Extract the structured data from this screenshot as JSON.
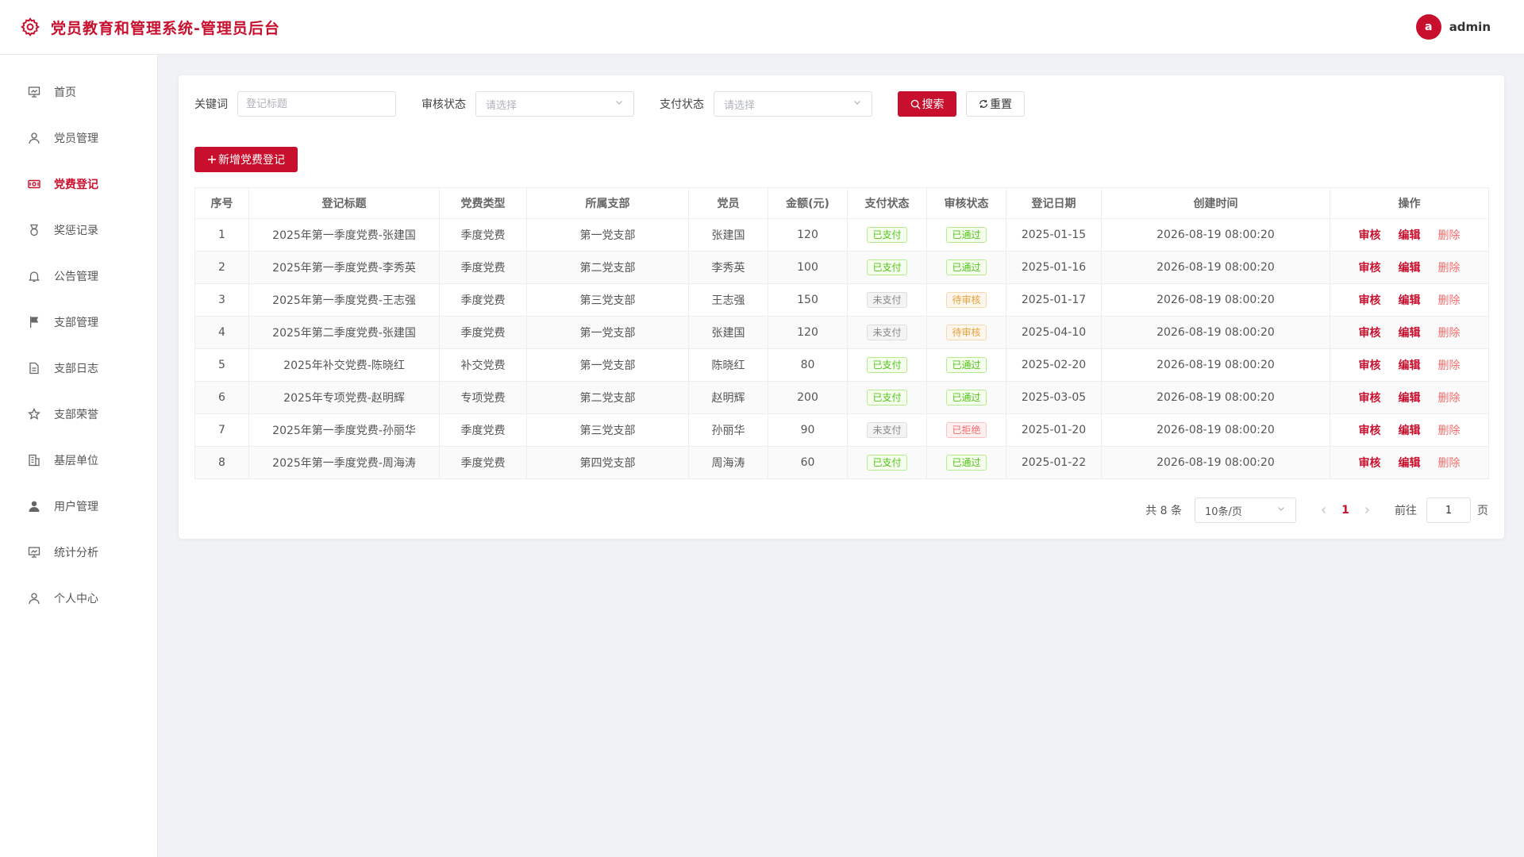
{
  "header": {
    "title": "党员教育和管理系统-管理员后台",
    "avatar_letter": "a",
    "username": "admin",
    "logo_icon": "gear-icon"
  },
  "sidebar": {
    "items": [
      {
        "label": "首页",
        "icon": "presentation-icon",
        "active": false
      },
      {
        "label": "党员管理",
        "icon": "user-icon",
        "active": false
      },
      {
        "label": "党费登记",
        "icon": "money-icon",
        "active": true
      },
      {
        "label": "奖惩记录",
        "icon": "medal-icon",
        "active": false
      },
      {
        "label": "公告管理",
        "icon": "bell-icon",
        "active": false
      },
      {
        "label": "支部管理",
        "icon": "flag-icon",
        "active": false
      },
      {
        "label": "支部日志",
        "icon": "document-icon",
        "active": false
      },
      {
        "label": "支部荣誉",
        "icon": "star-icon",
        "active": false
      },
      {
        "label": "基层单位",
        "icon": "building-icon",
        "active": false
      },
      {
        "label": "用户管理",
        "icon": "user-filled-icon",
        "active": false
      },
      {
        "label": "统计分析",
        "icon": "chart-board-icon",
        "active": false
      },
      {
        "label": "个人中心",
        "icon": "user-icon",
        "active": false
      }
    ]
  },
  "filters": {
    "keyword_label": "关键词",
    "keyword_placeholder": "登记标题",
    "keyword_value": "",
    "audit_label": "审核状态",
    "audit_placeholder": "请选择",
    "pay_label": "支付状态",
    "pay_placeholder": "请选择",
    "search_label": "搜索",
    "reset_label": "重置"
  },
  "add_button_label": "新增党费登记",
  "table": {
    "columns": [
      "序号",
      "登记标题",
      "党费类型",
      "所属支部",
      "党员",
      "金额(元)",
      "支付状态",
      "审核状态",
      "登记日期",
      "创建时间",
      "操作"
    ],
    "action_labels": {
      "audit": "审核",
      "edit": "编辑",
      "delete": "删除"
    },
    "rows": [
      {
        "no": "1",
        "title": "2025年第一季度党费-张建国",
        "type": "季度党费",
        "branch": "第一党支部",
        "member": "张建国",
        "amount": "120",
        "pay": "已支付",
        "pay_color": "green",
        "audit": "已通过",
        "audit_color": "green",
        "date": "2025-01-15",
        "created": "2026-08-19 08:00:20"
      },
      {
        "no": "2",
        "title": "2025年第一季度党费-李秀英",
        "type": "季度党费",
        "branch": "第二党支部",
        "member": "李秀英",
        "amount": "100",
        "pay": "已支付",
        "pay_color": "green",
        "audit": "已通过",
        "audit_color": "green",
        "date": "2025-01-16",
        "created": "2026-08-19 08:00:20"
      },
      {
        "no": "3",
        "title": "2025年第一季度党费-王志强",
        "type": "季度党费",
        "branch": "第三党支部",
        "member": "王志强",
        "amount": "150",
        "pay": "未支付",
        "pay_color": "grey",
        "audit": "待审核",
        "audit_color": "orange",
        "date": "2025-01-17",
        "created": "2026-08-19 08:00:20"
      },
      {
        "no": "4",
        "title": "2025年第二季度党费-张建国",
        "type": "季度党费",
        "branch": "第一党支部",
        "member": "张建国",
        "amount": "120",
        "pay": "未支付",
        "pay_color": "grey",
        "audit": "待审核",
        "audit_color": "orange",
        "date": "2025-04-10",
        "created": "2026-08-19 08:00:20"
      },
      {
        "no": "5",
        "title": "2025年补交党费-陈晓红",
        "type": "补交党费",
        "branch": "第一党支部",
        "member": "陈晓红",
        "amount": "80",
        "pay": "已支付",
        "pay_color": "green",
        "audit": "已通过",
        "audit_color": "green",
        "date": "2025-02-20",
        "created": "2026-08-19 08:00:20"
      },
      {
        "no": "6",
        "title": "2025年专项党费-赵明辉",
        "type": "专项党费",
        "branch": "第二党支部",
        "member": "赵明辉",
        "amount": "200",
        "pay": "已支付",
        "pay_color": "green",
        "audit": "已通过",
        "audit_color": "green",
        "date": "2025-03-05",
        "created": "2026-08-19 08:00:20"
      },
      {
        "no": "7",
        "title": "2025年第一季度党费-孙丽华",
        "type": "季度党费",
        "branch": "第三党支部",
        "member": "孙丽华",
        "amount": "90",
        "pay": "未支付",
        "pay_color": "grey",
        "audit": "已拒绝",
        "audit_color": "red",
        "date": "2025-01-20",
        "created": "2026-08-19 08:00:20"
      },
      {
        "no": "8",
        "title": "2025年第一季度党费-周海涛",
        "type": "季度党费",
        "branch": "第四党支部",
        "member": "周海涛",
        "amount": "60",
        "pay": "已支付",
        "pay_color": "green",
        "audit": "已通过",
        "audit_color": "green",
        "date": "2025-01-22",
        "created": "2026-08-19 08:00:20"
      }
    ]
  },
  "pagination": {
    "total_text": "共 8 条",
    "page_size": "10条/页",
    "current_page": "1",
    "goto_label": "前往",
    "goto_value": "1",
    "page_suffix": "页"
  },
  "colors": {
    "accent": "#c8102e"
  }
}
